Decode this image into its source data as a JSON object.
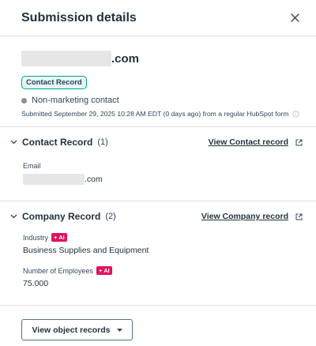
{
  "header": {
    "title": "Submission details"
  },
  "summary": {
    "email_domain": ".com",
    "record_badge": "Contact Record",
    "contact_status": "Non-marketing contact",
    "submitted_text": "Submitted September 29, 2025 10:28 AM EDT (0 days ago) from a regular HubSpot form"
  },
  "contact_section": {
    "title": "Contact Record",
    "count": "(1)",
    "view_link": "View Contact record",
    "fields": [
      {
        "label": "Email",
        "value": ".com"
      }
    ]
  },
  "company_section": {
    "title": "Company Record",
    "count": "(2)",
    "view_link": "View Company record",
    "fields": [
      {
        "label": "Industry",
        "ai_badge": "+ AI",
        "value": "Business Supplies and Equipment"
      },
      {
        "label": "Number of Employees",
        "ai_badge": "+ AI",
        "value": "75.000"
      }
    ]
  },
  "footer": {
    "dropdown_label": "View object records"
  },
  "colors": {
    "badge_border": "#00a38d",
    "badge_bg": "#e5f8f6",
    "ai_badge": "#e0115f",
    "divider": "#dfe3eb",
    "status_dot": "#8f8f8f"
  },
  "icons": [
    "close-icon",
    "info-icon",
    "chevron-down-icon",
    "external-link-icon",
    "caret-down-icon"
  ]
}
